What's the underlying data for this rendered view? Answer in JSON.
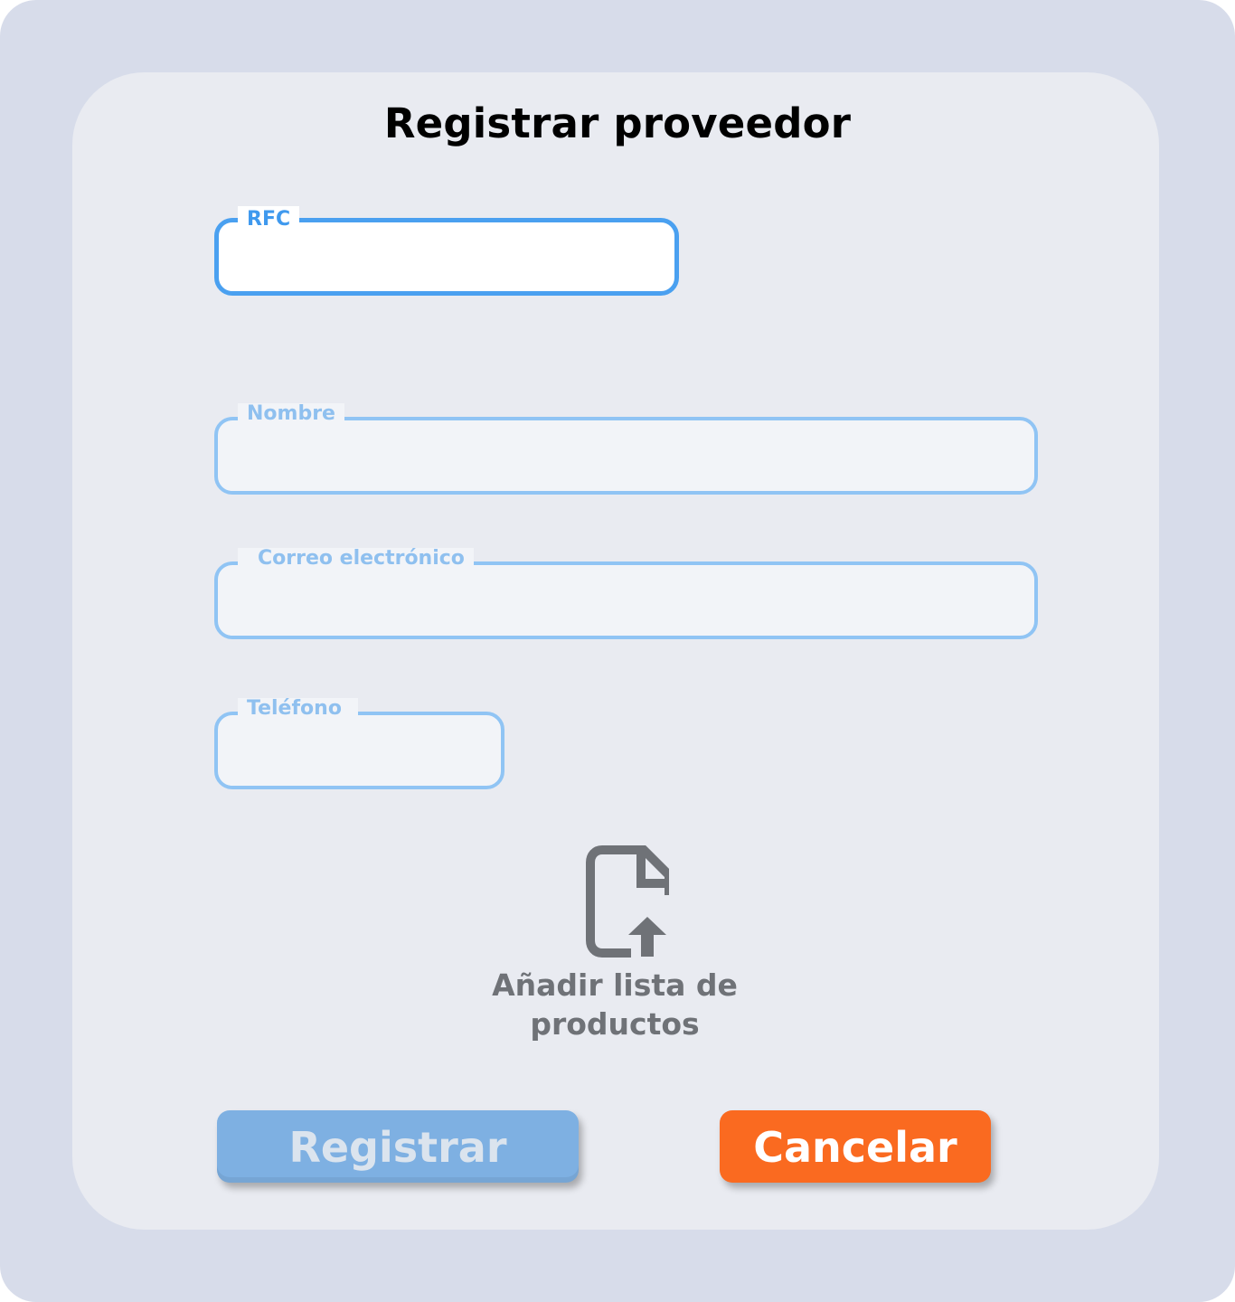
{
  "page": {
    "title": "Registrar proveedor"
  },
  "fields": {
    "rfc": {
      "label": "RFC",
      "value": "",
      "state": "focused"
    },
    "nombre": {
      "label": "Nombre",
      "value": ""
    },
    "correo": {
      "label": "Correo electrónico",
      "value": ""
    },
    "telefono": {
      "label": "Teléfono",
      "value": ""
    }
  },
  "upload": {
    "icon": "file-upload-icon",
    "label_line1": "Añadir lista de",
    "label_line2": "productos"
  },
  "actions": {
    "register_label": "Registrar",
    "register_state": "disabled",
    "cancel_label": "Cancelar"
  },
  "colors": {
    "background": "#d7dcea",
    "card": "#e9ebf1",
    "field_border": "#90c4f4",
    "field_border_active": "#4aa0f0",
    "register_button": "#7eb0e2",
    "cancel_button": "#fa6a20",
    "upload_icon": "#6f7277"
  }
}
